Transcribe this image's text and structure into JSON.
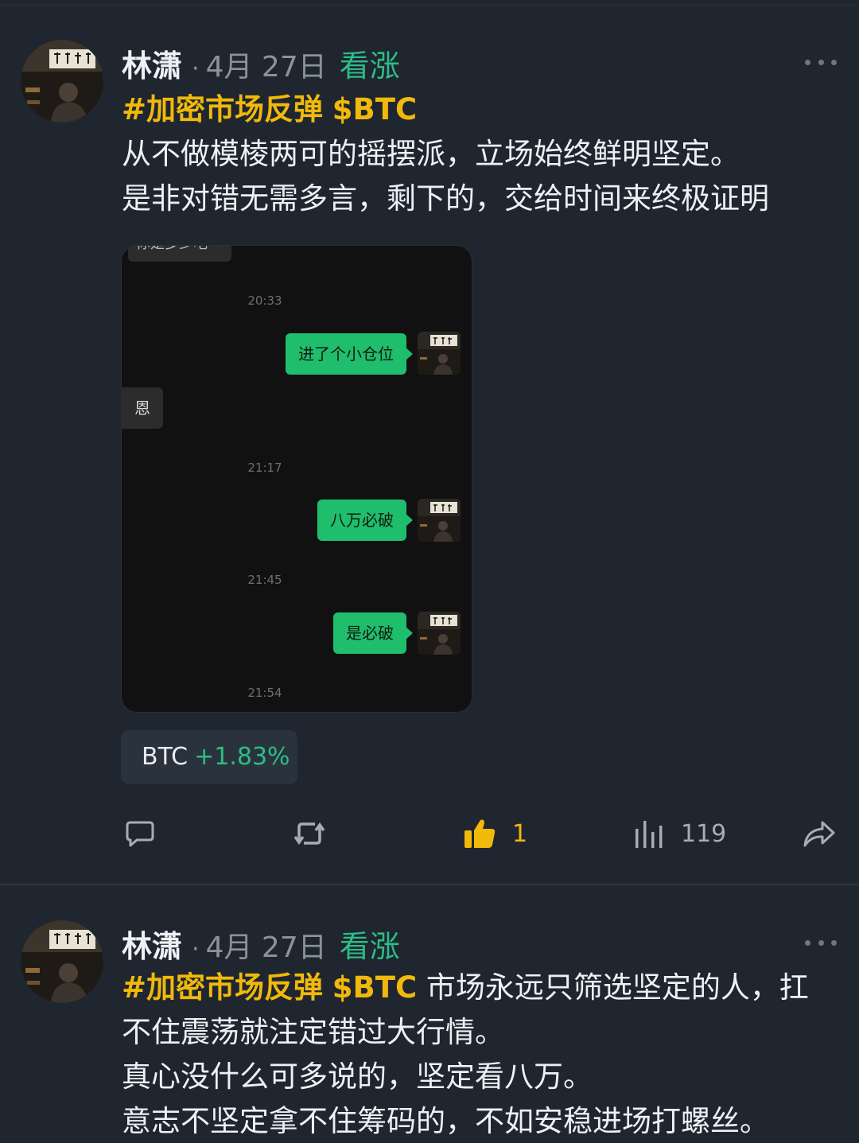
{
  "posts": [
    {
      "author": "林潇",
      "separator": "·",
      "date": "4月 27日",
      "sentiment": "看涨",
      "hashtag": "#加密市场反弹",
      "cashtag": "$BTC",
      "lines": [
        "从不做模棱两可的摇摆派，立场始终鲜明坚定。",
        "是非对错无需多言，剩下的，交给时间来终极证明"
      ],
      "chat": {
        "top_cut_text": "你是多少吧",
        "messages": [
          {
            "time": "20:33",
            "text": "进了个小仓位"
          },
          {
            "incoming": "恩"
          },
          {
            "time": "21:17",
            "text": "八万必破"
          },
          {
            "time": "21:45",
            "text": "是必破"
          },
          {
            "time": "21:54"
          }
        ]
      },
      "ticker": {
        "symbol": "BTC",
        "change": "+1.83%"
      },
      "actions": {
        "likes": "1",
        "views": "119"
      }
    },
    {
      "author": "林潇",
      "separator": "·",
      "date": "4月 27日",
      "sentiment": "看涨",
      "hashtag": "#加密市场反弹",
      "cashtag": "$BTC",
      "first_line_rest": "市场永远只筛选坚定的人，扛",
      "lines": [
        "不住震荡就注定错过大行情。",
        "真心没什么可多说的，坚定看八万。",
        "意志不坚定拿不住筹码的，不如安稳进场打螺丝。"
      ]
    }
  ],
  "colors": {
    "bullish": "#2dbd85",
    "hashtag": "#f0b90b",
    "chat_bubble": "#1fbe6c",
    "background": "#1f2630"
  },
  "icons": [
    "more-icon",
    "comment-icon",
    "repost-icon",
    "thumbs-up-icon",
    "views-icon",
    "share-icon"
  ]
}
